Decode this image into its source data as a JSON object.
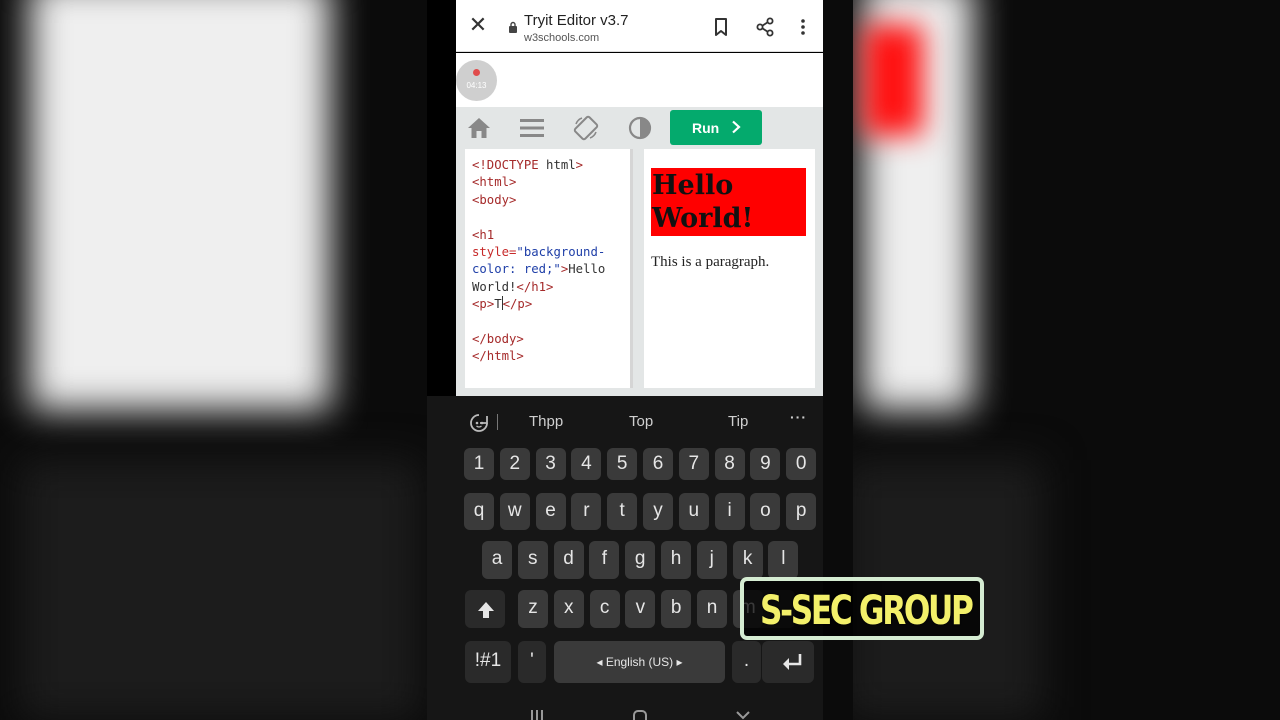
{
  "browser": {
    "title": "Tryit Editor v3.7",
    "url": "w3schools.com"
  },
  "recording": {
    "time": "04:13"
  },
  "toolbar": {
    "run_label": "Run",
    "run_color": "#04aa6d"
  },
  "code_lines": [
    "<!DOCTYPE html>",
    "<html>",
    "<body>",
    "",
    "<h1",
    "style=\"background-",
    "color: red;\">Hello",
    "World!</h1>",
    "<p>T</p>",
    "",
    "</body>",
    "</html>"
  ],
  "preview": {
    "heading_line1": "Hello",
    "heading_line2": "World!",
    "heading_bg": "#ff0000",
    "paragraph": "This is a paragraph."
  },
  "keyboard": {
    "suggestions": [
      "Thpp",
      "Top",
      "Tip"
    ],
    "number_row": [
      "1",
      "2",
      "3",
      "4",
      "5",
      "6",
      "7",
      "8",
      "9",
      "0"
    ],
    "row_q": [
      "q",
      "w",
      "e",
      "r",
      "t",
      "y",
      "u",
      "i",
      "o",
      "p"
    ],
    "row_a": [
      "a",
      "s",
      "d",
      "f",
      "g",
      "h",
      "j",
      "k",
      "l"
    ],
    "row_z": [
      "z",
      "x",
      "c",
      "v",
      "b",
      "n",
      "m"
    ],
    "symbols_key": "!#1",
    "apostrophe_key": "'",
    "space_label": "English (US)",
    "period_key": "."
  },
  "overlay": {
    "brand": "S-SEC GROUP",
    "text_color": "#f3f06a",
    "border_color": "#d5ecd2"
  }
}
